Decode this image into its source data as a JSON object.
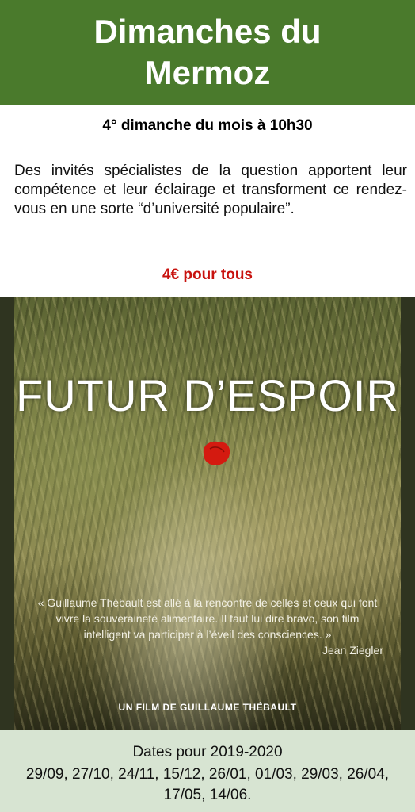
{
  "header": {
    "title": "Dimanches du Mermoz"
  },
  "schedule": "4° dimanche du mois à 10h30",
  "description": "Des invités spécialistes de la question apportent leur compétence et leur éclairage et  transforment ce rendez-vous en une sorte “d’université populaire”.",
  "price": "4€ pour tous",
  "poster": {
    "title": "FUTUR D’ESPOIR",
    "quote": "« Guillaume Thébault est allé à la rencontre de celles et ceux qui font vivre la souveraineté alimentaire. Il faut lui dire bravo, son film intelligent va participer à l’éveil des consciences. »",
    "quote_author": "Jean Ziegler",
    "credit": "UN FILM DE GUILLAUME THÉBAULT"
  },
  "footer": {
    "label": "Dates pour 2019-2020",
    "dates": "29/09, 27/10, 24/11, 15/12, 26/01, 01/03, 29/03, 26/04, 17/05, 14/06."
  },
  "colors": {
    "header_bg": "#4a7a2c",
    "price": "#c8120e",
    "footer_bg": "#d7e4d2",
    "poppy": "#d41a10"
  }
}
